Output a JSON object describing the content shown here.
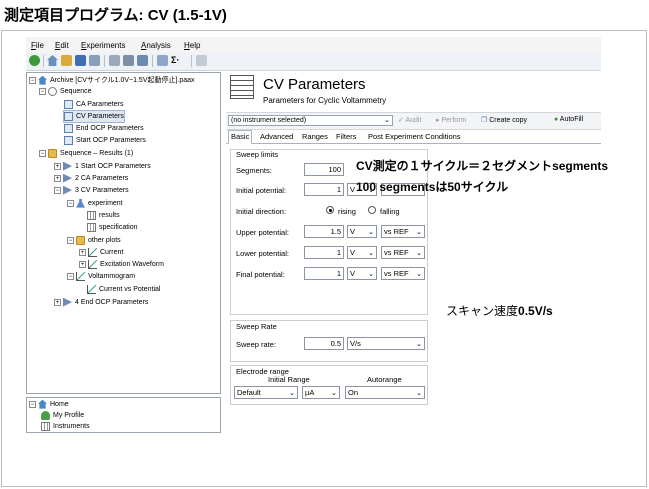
{
  "slide": {
    "title": "測定項目プログラム: CV (1.5-1V)",
    "annotation_segments_1": "CV測定の１サイクル＝２セグメントsegments",
    "annotation_segments_2": "100 segmentsは50サイクル",
    "annotation_sweep_jp": "スキャン速度",
    "annotation_sweep_value": "0.5V/s"
  },
  "menu": [
    "File",
    "Edit",
    "Experiments",
    "Analysis",
    "Help"
  ],
  "toolbar": {
    "icons": [
      "back-icon",
      "home-icon",
      "open-icon",
      "save-icon",
      "print-icon",
      "edit-icon",
      "filter-icon",
      "settings-icon",
      "sigma-icon",
      "pin-icon"
    ],
    "sigma_label": "Σ·"
  },
  "tree": {
    "expanders": {
      "collapse": "−",
      "expand": "+"
    },
    "archive": "Archive [CVサイクル1.0V−1.5V起動停止].paax",
    "sequence": "Sequence",
    "seq_items": [
      "CA Parameters",
      "CV Parameters",
      "End OCP Parameters",
      "Start OCP Parameters"
    ],
    "results": "Sequence – Results (1)",
    "res_items": [
      "1 Start OCP Parameters",
      "2 CA Parameters",
      "3 CV Parameters"
    ],
    "experiment": "experiment",
    "exp_children": [
      "results",
      "specification"
    ],
    "other_plots": "other plots",
    "plot_children": [
      "Current",
      "Excitation Waveform"
    ],
    "voltammogram": "Voltammogram",
    "volt_children": [
      "Current vs Potential"
    ],
    "end_item": "4 End OCP Parameters"
  },
  "bottom_tree": [
    "Home",
    "My Profile",
    "Instruments"
  ],
  "panel": {
    "title": "CV Parameters",
    "subtitle": "Parameters for Cyclic Voltammetry",
    "instrument": "(no instrument selected)",
    "buttons": {
      "audit": "Audit",
      "perform": "Perform",
      "create_copy": "Create copy",
      "autofill": "AutoFill"
    },
    "tabs": [
      "Basic",
      "Advanced",
      "Ranges",
      "Filters",
      "Post Experiment Conditions"
    ]
  },
  "sweep_limits": {
    "group": "Sweep limits",
    "segments_label": "Segments:",
    "segments_value": "100",
    "initial_label": "Initial potential:",
    "initial_value": "1",
    "initial_unit": "V",
    "direction_label": "Initial direction:",
    "rising": "rising",
    "falling": "falling",
    "upper_label": "Upper potential:",
    "upper_value": "1.5",
    "upper_unit": "V",
    "upper_ref": "vs REF",
    "lower_label": "Lower potential:",
    "lower_value": "1",
    "lower_unit": "V",
    "lower_ref": "vs REF",
    "final_label": "Final potential:",
    "final_value": "1",
    "final_unit": "V",
    "final_ref": "vs REF"
  },
  "sweep_rate": {
    "group": "Sweep Rate",
    "label": "Sweep rate:",
    "value": "0.5",
    "unit": "V/s"
  },
  "electrode_range": {
    "group": "Electrode range",
    "initial_header": "Initial Range",
    "autorange_header": "Autorange",
    "initial_value": "Default",
    "unit": "µA",
    "autorange_value": "On"
  },
  "colors": {
    "accent": "#3c8a2e",
    "selection": "#dfe7f3",
    "border": "#9aa4ae"
  }
}
